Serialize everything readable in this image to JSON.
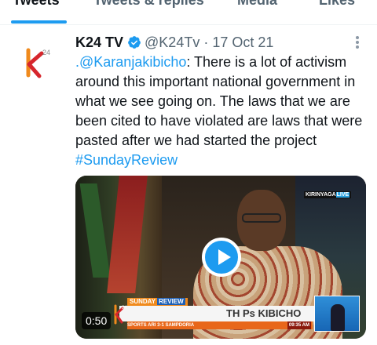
{
  "tabs": [
    {
      "label": "Tweets",
      "active": true
    },
    {
      "label": "Tweets & replies",
      "active": false
    },
    {
      "label": "Media",
      "active": false
    },
    {
      "label": "Likes",
      "active": false
    }
  ],
  "tweet": {
    "display_name": "K24 TV",
    "handle": "@K24Tv",
    "separator": "·",
    "date": "17 Oct 21",
    "verified": true,
    "text_prefix": ".",
    "mention": "@Karanjakibicho",
    "text_body": ": There is a lot of activism around this important national government in what we see going on. The laws that we are been cited to have violated are laws that were pasted after we had started the project",
    "hashtag": "#SundayReview",
    "avatar_logo_text": "24"
  },
  "video": {
    "duration": "0:50",
    "play_icon": "play-icon",
    "overlay_channel": "KIRINYAGA",
    "overlay_live": "LIVE",
    "lower_third_show": "SUNDAY",
    "lower_third_show_2": "REVIEW",
    "lower_third_name": "TH Ps KIBICHO",
    "ticker_text": "SPORTS  ARI 3-1 SAMPDORIA",
    "ticker_time": "09:35 AM",
    "bug_logo_text": "24"
  },
  "colors": {
    "accent": "#1d9bf0",
    "text": "#0f1419",
    "muted": "#536471",
    "brand_orange": "#f08a1c",
    "brand_red": "#d6262c"
  }
}
